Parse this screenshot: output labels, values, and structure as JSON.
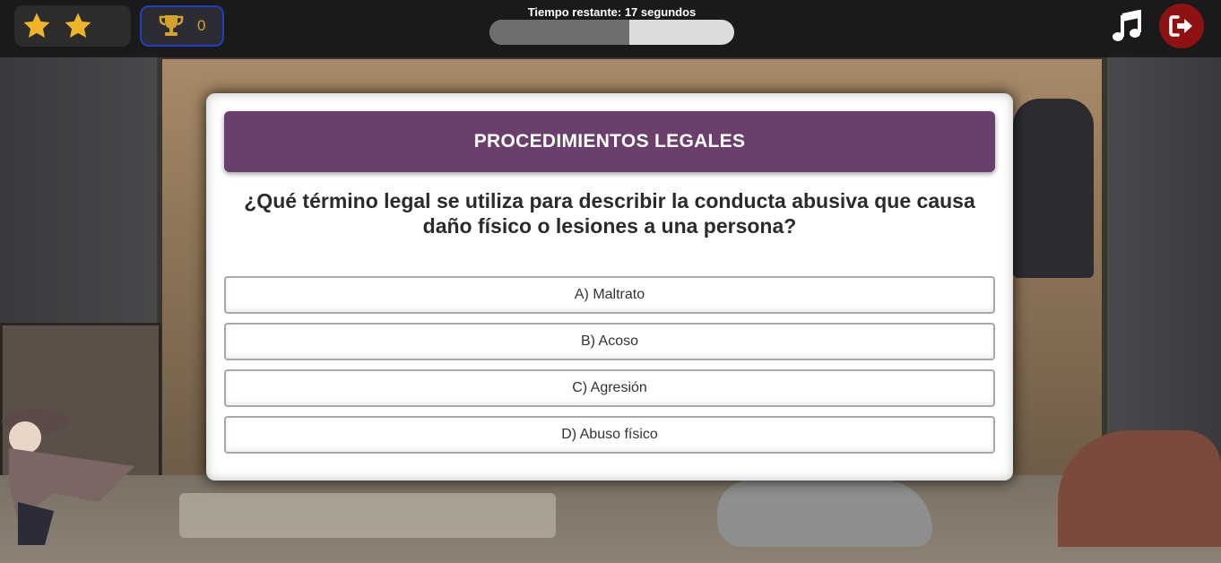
{
  "header": {
    "stars": {
      "count": 2,
      "icon": "star-icon",
      "color": "#f0b429"
    },
    "trophy": {
      "icon": "trophy-icon",
      "score": "0",
      "color": "#d4a12a"
    },
    "timer": {
      "label": "Tiempo restante: 17 segundos",
      "remaining_fraction": 0.57
    },
    "music_icon": "music-note-icon",
    "exit_icon": "sign-out-icon",
    "exit_color": "#8e1212"
  },
  "quiz": {
    "category": "PROCEDIMIENTOS LEGALES",
    "category_color": "#6a3f6b",
    "question": "¿Qué término legal se utiliza para describir la conducta abusiva que causa daño físico o lesiones a una persona?",
    "answers": [
      {
        "label": "A) Maltrato"
      },
      {
        "label": "B) Acoso"
      },
      {
        "label": "C) Agresión"
      },
      {
        "label": "D) Abuso físico"
      }
    ]
  }
}
